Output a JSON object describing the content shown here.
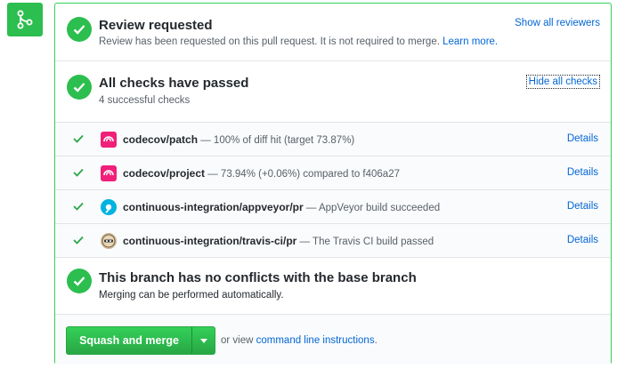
{
  "review": {
    "title": "Review requested",
    "subtitle": "Review has been requested on this pull request. It is not required to merge.",
    "learn_more": "Learn more.",
    "show_all": "Show all reviewers"
  },
  "checks": {
    "title": "All checks have passed",
    "subtitle": "4 successful checks",
    "hide_all": "Hide all checks",
    "items": [
      {
        "name": "codecov/patch",
        "desc": " — 100% of diff hit (target 73.87%)",
        "details": "Details",
        "icon": "codecov-icon"
      },
      {
        "name": "codecov/project",
        "desc": " — 73.94% (+0.06%) compared to f406a27",
        "details": "Details",
        "icon": "codecov-icon"
      },
      {
        "name": "continuous-integration/appveyor/pr",
        "desc": " — AppVeyor build succeeded",
        "details": "Details",
        "icon": "appveyor-icon"
      },
      {
        "name": "continuous-integration/travis-ci/pr",
        "desc": " — The Travis CI build passed",
        "details": "Details",
        "icon": "travis-icon"
      }
    ]
  },
  "conflicts": {
    "title": "This branch has no conflicts with the base branch",
    "subtitle": "Merging can be performed automatically."
  },
  "merge": {
    "button_label": "Squash and merge",
    "or_view": "or view ",
    "cli_link": "command line instructions",
    "period": "."
  },
  "colors": {
    "success": "#2cbe4e",
    "link": "#0366d6",
    "codecov": "#f01f7a",
    "appveyor": "#00b3e0"
  }
}
